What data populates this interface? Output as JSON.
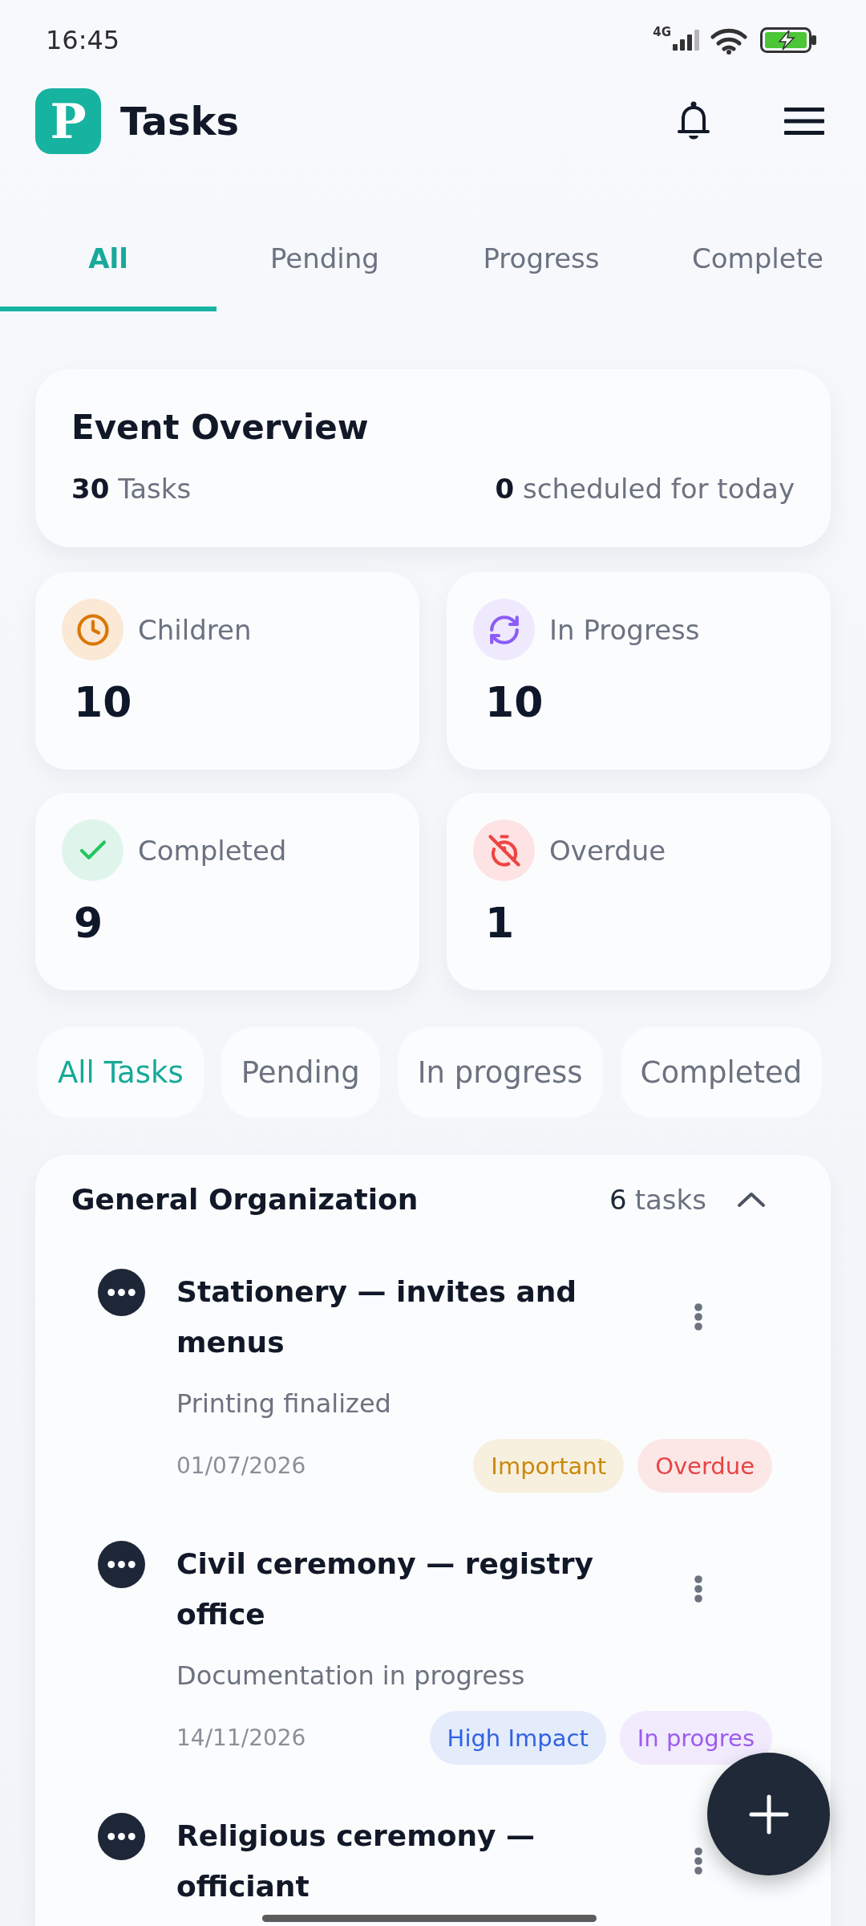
{
  "status_bar": {
    "time": "16:45",
    "network": "4G"
  },
  "header": {
    "logo_letter": "P",
    "title": "Tasks"
  },
  "tabs": [
    {
      "label": "All",
      "selected": true
    },
    {
      "label": "Pending",
      "selected": false
    },
    {
      "label": "Progress",
      "selected": false
    },
    {
      "label": "Complete",
      "selected": false
    }
  ],
  "overview": {
    "title": "Event Overview",
    "total": "**30** Tasks",
    "today": "**0** scheduled for today"
  },
  "stats": [
    {
      "kind": "pending",
      "label": "Children",
      "value": "10"
    },
    {
      "kind": "in_progress",
      "label": "In Progress",
      "value": "10"
    },
    {
      "kind": "completed",
      "label": "Completed",
      "value": "9"
    },
    {
      "kind": "overdue",
      "label": "Overdue",
      "value": "1"
    }
  ],
  "filters": [
    {
      "label": "All Tasks",
      "selected": true
    },
    {
      "label": "Pending",
      "selected": false
    },
    {
      "label": "In progress",
      "selected": false
    },
    {
      "label": "Completed",
      "selected": false
    }
  ],
  "group": {
    "title": "General Organization",
    "count": "6",
    "count_label": "tasks",
    "expanded": true,
    "tasks": [
      {
        "title": "Stationery — invites and menus",
        "description": "Printing finalized",
        "date": "01/07/2026",
        "tags": [
          {
            "label": "Important",
            "color": "#c98a0b"
          },
          {
            "label": "Overdue",
            "color": "#e84444"
          }
        ]
      },
      {
        "title": "Civil ceremony — registry office",
        "description": "Documentation in progress",
        "date": "14/11/2026",
        "tags": [
          {
            "label": "High Impact",
            "color": "#2f63e3"
          },
          {
            "label": "In progres",
            "color": "#9b5cf0"
          }
        ]
      },
      {
        "title": "Religious ceremony — officiant"
      }
    ]
  }
}
